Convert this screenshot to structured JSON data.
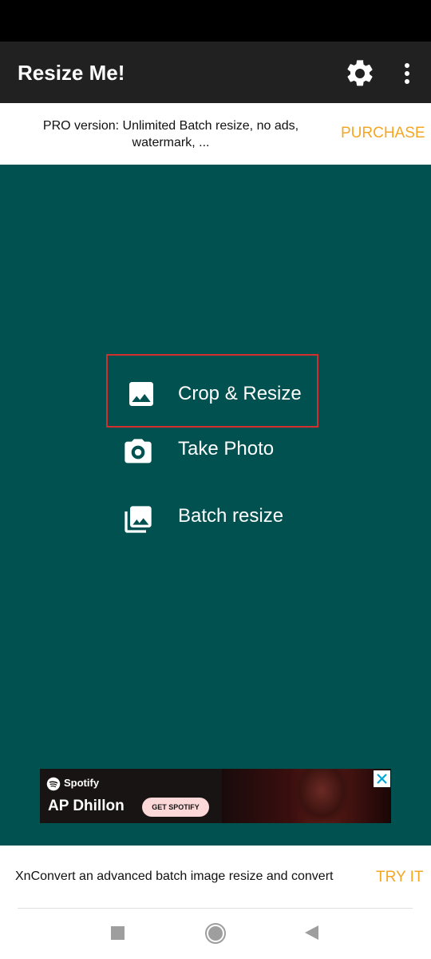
{
  "app": {
    "title": "Resize Me!"
  },
  "appbar": {
    "settings_icon": "gear-icon",
    "overflow_icon": "more-vert-icon"
  },
  "promo": {
    "text": "PRO version: Unlimited Batch resize, no ads, watermark, ...",
    "action": "PURCHASE"
  },
  "menu": {
    "items": [
      {
        "label": "Crop & Resize",
        "icon": "image-icon",
        "highlighted": true
      },
      {
        "label": "Take Photo",
        "icon": "camera-icon"
      },
      {
        "label": "Batch resize",
        "icon": "photo-library-icon"
      }
    ]
  },
  "ad": {
    "brand": "Spotify",
    "artist": "AP Dhillon",
    "cta": "GET SPOTIFY",
    "close_icon": "close-icon"
  },
  "bottom_banner": {
    "text": "XnConvert an advanced batch image resize and convert",
    "action": "TRY IT"
  },
  "colors": {
    "background": "#005150",
    "accent": "#f5a623",
    "highlight_border": "#d32f2f"
  }
}
